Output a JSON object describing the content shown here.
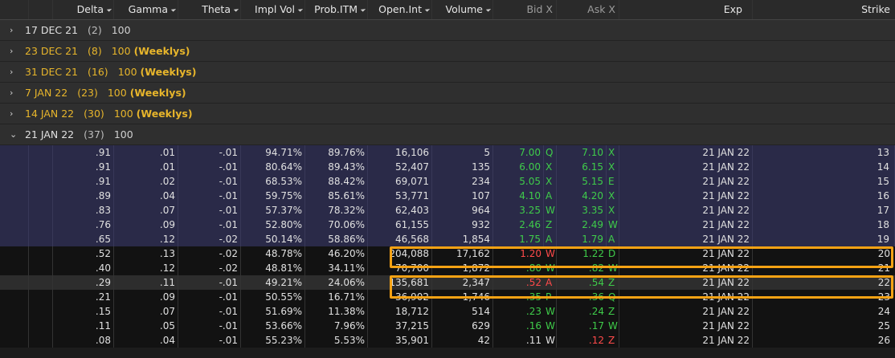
{
  "header": {
    "columns": [
      "",
      "",
      "Delta",
      "Gamma",
      "Theta",
      "Impl Vol",
      "Prob.ITM",
      "Open.Int",
      "Volume",
      "Bid X",
      "Ask X",
      "Exp",
      "Strike"
    ]
  },
  "series": [
    {
      "date": "17 DEC 21",
      "count": "(2)",
      "mult": "100",
      "weekly": "",
      "expanded": false
    },
    {
      "date": "23 DEC 21",
      "count": "(8)",
      "mult": "100",
      "weekly": "(Weeklys)",
      "expanded": false
    },
    {
      "date": "31 DEC 21",
      "count": "(16)",
      "mult": "100",
      "weekly": "(Weeklys)",
      "expanded": false
    },
    {
      "date": "7 JAN 22",
      "count": "(23)",
      "mult": "100",
      "weekly": "(Weeklys)",
      "expanded": false
    },
    {
      "date": "14 JAN 22",
      "count": "(30)",
      "mult": "100",
      "weekly": "(Weeklys)",
      "expanded": false
    },
    {
      "date": "21 JAN 22",
      "count": "(37)",
      "mult": "100",
      "weekly": "",
      "expanded": true
    }
  ],
  "rows": [
    {
      "itm": true,
      "delta": ".91",
      "gamma": ".01",
      "theta": "-.01",
      "iv": "94.71%",
      "prob": "89.76%",
      "oi": "16,106",
      "vol": "5",
      "bid": "7.00",
      "bidx": "Q",
      "ask": "7.10",
      "askx": "X",
      "exp": "21 JAN 22",
      "strike": "13",
      "bidc": "green",
      "askc": "green"
    },
    {
      "itm": true,
      "delta": ".91",
      "gamma": ".01",
      "theta": "-.01",
      "iv": "80.64%",
      "prob": "89.43%",
      "oi": "52,407",
      "vol": "135",
      "bid": "6.00",
      "bidx": "X",
      "ask": "6.15",
      "askx": "X",
      "exp": "21 JAN 22",
      "strike": "14",
      "bidc": "green",
      "askc": "green"
    },
    {
      "itm": true,
      "delta": ".91",
      "gamma": ".02",
      "theta": "-.01",
      "iv": "68.53%",
      "prob": "88.42%",
      "oi": "69,071",
      "vol": "234",
      "bid": "5.05",
      "bidx": "X",
      "ask": "5.15",
      "askx": "E",
      "exp": "21 JAN 22",
      "strike": "15",
      "bidc": "green",
      "askc": "green"
    },
    {
      "itm": true,
      "delta": ".89",
      "gamma": ".04",
      "theta": "-.01",
      "iv": "59.75%",
      "prob": "85.61%",
      "oi": "53,771",
      "vol": "107",
      "bid": "4.10",
      "bidx": "A",
      "ask": "4.20",
      "askx": "X",
      "exp": "21 JAN 22",
      "strike": "16",
      "bidc": "green",
      "askc": "green"
    },
    {
      "itm": true,
      "delta": ".83",
      "gamma": ".07",
      "theta": "-.01",
      "iv": "57.37%",
      "prob": "78.32%",
      "oi": "62,403",
      "vol": "964",
      "bid": "3.25",
      "bidx": "W",
      "ask": "3.35",
      "askx": "X",
      "exp": "21 JAN 22",
      "strike": "17",
      "bidc": "green",
      "askc": "green"
    },
    {
      "itm": true,
      "delta": ".76",
      "gamma": ".09",
      "theta": "-.01",
      "iv": "52.80%",
      "prob": "70.06%",
      "oi": "61,155",
      "vol": "932",
      "bid": "2.46",
      "bidx": "Z",
      "ask": "2.49",
      "askx": "W",
      "exp": "21 JAN 22",
      "strike": "18",
      "bidc": "green",
      "askc": "green"
    },
    {
      "itm": true,
      "delta": ".65",
      "gamma": ".12",
      "theta": "-.02",
      "iv": "50.14%",
      "prob": "58.86%",
      "oi": "46,568",
      "vol": "1,854",
      "bid": "1.75",
      "bidx": "A",
      "ask": "1.79",
      "askx": "A",
      "exp": "21 JAN 22",
      "strike": "19",
      "bidc": "green",
      "askc": "green"
    },
    {
      "itm": false,
      "alt": false,
      "delta": ".52",
      "gamma": ".13",
      "theta": "-.02",
      "iv": "48.78%",
      "prob": "46.20%",
      "oi": "204,088",
      "vol": "17,162",
      "bid": "1.20",
      "bidx": "W",
      "ask": "1.22",
      "askx": "D",
      "exp": "21 JAN 22",
      "strike": "20",
      "bidc": "red",
      "askc": "green"
    },
    {
      "itm": false,
      "alt": false,
      "delta": ".40",
      "gamma": ".12",
      "theta": "-.02",
      "iv": "48.81%",
      "prob": "34.11%",
      "oi": "70,700",
      "vol": "1,872",
      "bid": ".80",
      "bidx": "W",
      "ask": ".82",
      "askx": "W",
      "exp": "21 JAN 22",
      "strike": "21",
      "bidc": "green",
      "askc": "green"
    },
    {
      "itm": false,
      "alt": true,
      "delta": ".29",
      "gamma": ".11",
      "theta": "-.01",
      "iv": "49.21%",
      "prob": "24.06%",
      "oi": "135,681",
      "vol": "2,347",
      "bid": ".52",
      "bidx": "A",
      "ask": ".54",
      "askx": "Z",
      "exp": "21 JAN 22",
      "strike": "22",
      "bidc": "red",
      "askc": "green"
    },
    {
      "itm": false,
      "alt": false,
      "delta": ".21",
      "gamma": ".09",
      "theta": "-.01",
      "iv": "50.55%",
      "prob": "16.71%",
      "oi": "36,902",
      "vol": "1,746",
      "bid": ".35",
      "bidx": "P",
      "ask": ".36",
      "askx": "Q",
      "exp": "21 JAN 22",
      "strike": "23",
      "bidc": "green",
      "askc": "green"
    },
    {
      "itm": false,
      "alt": false,
      "delta": ".15",
      "gamma": ".07",
      "theta": "-.01",
      "iv": "51.69%",
      "prob": "11.38%",
      "oi": "18,712",
      "vol": "514",
      "bid": ".23",
      "bidx": "W",
      "ask": ".24",
      "askx": "Z",
      "exp": "21 JAN 22",
      "strike": "24",
      "bidc": "green",
      "askc": "green"
    },
    {
      "itm": false,
      "alt": false,
      "delta": ".11",
      "gamma": ".05",
      "theta": "-.01",
      "iv": "53.66%",
      "prob": "7.96%",
      "oi": "37,215",
      "vol": "629",
      "bid": ".16",
      "bidx": "W",
      "ask": ".17",
      "askx": "W",
      "exp": "21 JAN 22",
      "strike": "25",
      "bidc": "green",
      "askc": "green"
    },
    {
      "itm": false,
      "alt": false,
      "delta": ".08",
      "gamma": ".04",
      "theta": "-.01",
      "iv": "55.23%",
      "prob": "5.53%",
      "oi": "35,901",
      "vol": "42",
      "bid": ".11",
      "bidx": "W",
      "ask": ".12",
      "askx": "Z",
      "exp": "21 JAN 22",
      "strike": "26",
      "bidc": "white",
      "askc": "red"
    }
  ],
  "colors": {
    "itm_bg": "#2a2a48",
    "weekly": "#e7b52b",
    "green": "#3fcc4a",
    "red": "#ff4a4a",
    "highlight": "#f5a214"
  },
  "highlights": [
    "strike-20-row",
    "strike-22-row"
  ]
}
